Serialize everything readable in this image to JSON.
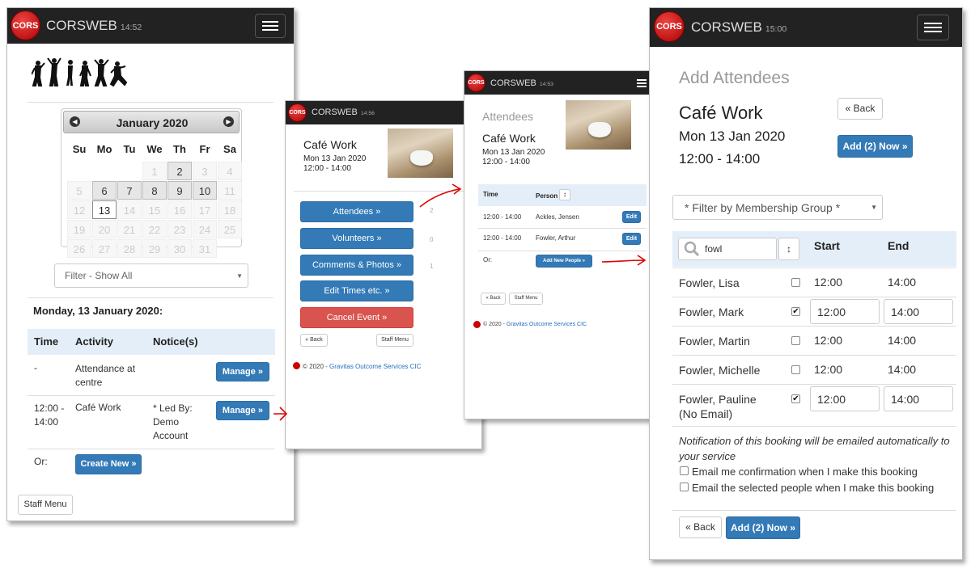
{
  "app": {
    "brand": "CORSWEB",
    "logo_text": "CORS"
  },
  "p1": {
    "time": "14:52",
    "month": "January 2020",
    "weekdays": [
      "Su",
      "Mo",
      "Tu",
      "We",
      "Th",
      "Fr",
      "Sa"
    ],
    "weeks": [
      [
        "",
        "",
        "",
        "",
        "1",
        "2",
        "3",
        "4"
      ],
      [
        "5",
        "6",
        "7",
        "8",
        "9",
        "10",
        "11"
      ],
      [
        "12",
        "13",
        "14",
        "15",
        "16",
        "17",
        "18"
      ],
      [
        "19",
        "20",
        "21",
        "22",
        "23",
        "24",
        "25"
      ],
      [
        "26",
        "27",
        "28",
        "29",
        "30",
        "31",
        ""
      ]
    ],
    "filter": "Filter - Show All",
    "date_heading": "Monday, 13 January 2020:",
    "cols": {
      "time": "Time",
      "activity": "Activity",
      "notices": "Notice(s)"
    },
    "rows": [
      {
        "time": "-",
        "activity": "Attendance at centre",
        "notice": "",
        "btn": "Manage »"
      },
      {
        "time": "12:00 - 14:00",
        "activity": "Café Work",
        "notice": "* Led By: Demo Account",
        "btn": "Manage »"
      }
    ],
    "or": "Or:",
    "create": "Create New »",
    "staff": "Staff Menu"
  },
  "p2": {
    "time": "14:56",
    "title": "Café Work",
    "date": "Mon 13 Jan 2020",
    "times": "12:00 - 14:00",
    "buttons": [
      {
        "label": "Attendees »",
        "count": "2"
      },
      {
        "label": "Volunteers »",
        "count": "0"
      },
      {
        "label": "Comments & Photos »",
        "count": "1"
      },
      {
        "label": "Edit Times etc. »",
        "count": ""
      }
    ],
    "cancel": "Cancel Event »",
    "back": "« Back",
    "staff": "Staff Menu",
    "footer_prefix": "© 2020 -",
    "footer_link": "Gravitas Outcome Services CIC"
  },
  "p3": {
    "time": "14:53",
    "heading": "Attendees",
    "title": "Café Work",
    "date": "Mon 13 Jan 2020",
    "times": "12:00 - 14:00",
    "cols": {
      "time": "Time",
      "person": "Person",
      "sort": "↕"
    },
    "rows": [
      {
        "time": "12:00 - 14:00",
        "person": "Ackles, Jensen",
        "btn": "Edit"
      },
      {
        "time": "12:00 - 14:00",
        "person": "Fowler, Arthur",
        "btn": "Edit"
      }
    ],
    "or": "Or:",
    "add": "Add New People »",
    "back": "« Back",
    "staff": "Staff Menu",
    "footer_prefix": "© 2020 -",
    "footer_link": "Gravitas Outcome Services CIC"
  },
  "p4": {
    "time": "15:00",
    "heading": "Add Attendees",
    "title": "Café Work",
    "date": "Mon 13 Jan 2020",
    "times": "12:00 - 14:00",
    "back": "« Back",
    "add_now": "Add (2) Now »",
    "filter": "* Filter by Membership Group *",
    "search_value": "fowl",
    "sort": "↕",
    "cols": {
      "start": "Start",
      "end": "End"
    },
    "people": [
      {
        "name": "Fowler, Lisa",
        "checked": false,
        "start": "12:00",
        "end": "14:00"
      },
      {
        "name": "Fowler, Mark",
        "checked": true,
        "start": "12:00",
        "end": "14:00"
      },
      {
        "name": "Fowler, Martin",
        "checked": false,
        "start": "12:00",
        "end": "14:00"
      },
      {
        "name": "Fowler, Michelle",
        "checked": false,
        "start": "12:00",
        "end": "14:00"
      },
      {
        "name": "Fowler, Pauline (No Email)",
        "checked": true,
        "start": "12:00",
        "end": "14:00"
      }
    ],
    "notification": "Notification of this booking will be emailed automatically to your service",
    "opt1": "Email me confirmation when I make this booking",
    "opt2": "Email the selected people when I make this booking",
    "back2": "« Back",
    "add_now2": "Add (2) Now »"
  }
}
